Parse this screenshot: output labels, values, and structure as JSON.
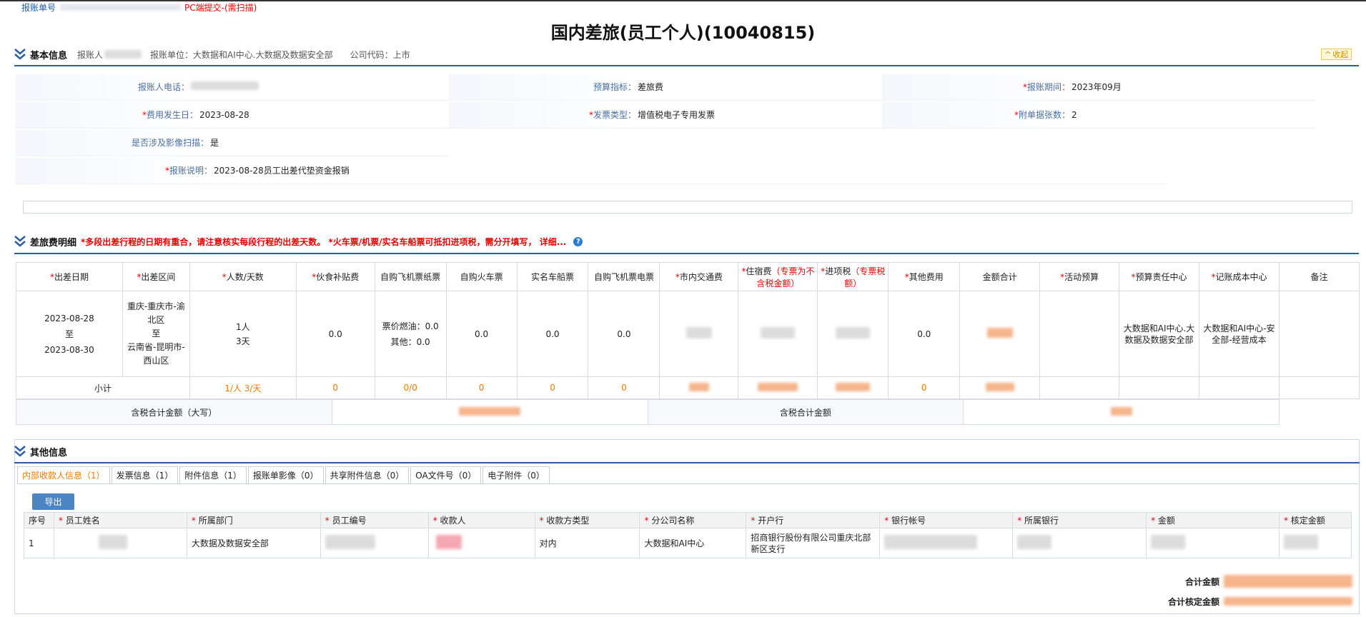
{
  "top": {
    "doc_no_label": "报账单号",
    "pc_submit": "PC端提交-(需扫描)"
  },
  "header": {
    "title": "国内差旅(员工个人)(10040815)"
  },
  "basic": {
    "section_title": "基本信息",
    "reporter_label": "报账人",
    "unit_label": "报账单位：大数据和AI中心.大数据及数据安全部",
    "company_label": "公司代码：上市",
    "collapse": "收起",
    "fields": {
      "phone_label": "报账人电话：",
      "budget_label": "预算指标：",
      "budget_value": "差旅费",
      "period_label": "报账期间：",
      "period_value": "2023年09月",
      "cost_date_label": "费用发生日：",
      "cost_date_value": "2023-08-28",
      "invoice_type_label": "发票类型：",
      "invoice_type_value": "增值税电子专用发票",
      "attach_count_label": "附单据张数：",
      "attach_count_value": "2",
      "image_scan_label": "是否涉及影像扫描：",
      "image_scan_value": "是",
      "desc_label": "报账说明：",
      "desc_value": "2023-08-28员工出差代垫资金报销"
    }
  },
  "travel": {
    "section_title": "差旅费明细",
    "warning": "*多段出差行程的日期有重合，请注意核实每段行程的出差天数。 *火车票/机票/实名车船票可抵扣进项税，需分开填写，  详细...",
    "headers": {
      "date": "出差日期",
      "route": "出差区间",
      "people_days": "人数/天数",
      "meal": "伙食补贴费",
      "flight_paper": "自购飞机票纸票",
      "train": "自购火车票",
      "ship": "实名车船票",
      "flight_e": "自购飞机票电票",
      "local_trans": "市内交通费",
      "hotel": "住宿费",
      "hotel_note": "（专票为不含税金额）",
      "input_tax": "进项税",
      "input_tax_note": "（专票税额）",
      "other": "其他费用",
      "total": "金额合计",
      "activity": "活动预算",
      "budget_center": "预算责任中心",
      "cost_center": "记账成本中心",
      "remark": "备注"
    },
    "row": {
      "date_from": "2023-08-28",
      "date_to_word": "至",
      "date_to": "2023-08-30",
      "route_from": "重庆-重庆市-渝北区",
      "route_to_word": "至",
      "route_to": "云南省-昆明市-西山区",
      "people": "1人",
      "days": "3天",
      "meal": "0.0",
      "flight_fuel": "票价燃油：0.0",
      "flight_other": "其他：0.0",
      "train": "0.0",
      "ship": "0.0",
      "flight_e": "0.0",
      "other": "0.0",
      "budget_center": "大数据和AI中心.大数据及数据安全部",
      "cost_center": "大数据和AI中心-安全部-经营成本"
    },
    "subtotal": {
      "label": "小计",
      "people_days": "1/人  3/天",
      "meal": "0",
      "flight_paper": "0/0",
      "train": "0",
      "ship": "0",
      "flight_e": "0",
      "other": "0"
    },
    "total_upper_label": "含税合计金额（大写）",
    "total_label": "含税合计金额"
  },
  "other": {
    "section_title": "其他信息",
    "tabs": [
      "内部收款人信息（1）",
      "发票信息（1）",
      "附件信息（1）",
      "报账单影像（0）",
      "共享附件信息（0）",
      "OA文件号（0）",
      "电子附件（0）"
    ],
    "export": "导出",
    "columns": [
      "序号",
      "员工姓名",
      "所属部门",
      "员工编号",
      "收款人",
      "收款方类型",
      "分公司名称",
      "开户行",
      "银行帐号",
      "所属银行",
      "金额",
      "核定金额"
    ],
    "row": {
      "seq": "1",
      "dept": "大数据及数据安全部",
      "payee_type": "对内",
      "branch": "大数据和AI中心",
      "bank": "招商银行股份有限公司重庆北部新区支行"
    },
    "sum_label": "合计金额",
    "approved_sum_label": "合计核定金额"
  },
  "colors": {
    "accent": "#2a5fa8",
    "required": "#e60000",
    "subtotal": "#ee7a00"
  }
}
